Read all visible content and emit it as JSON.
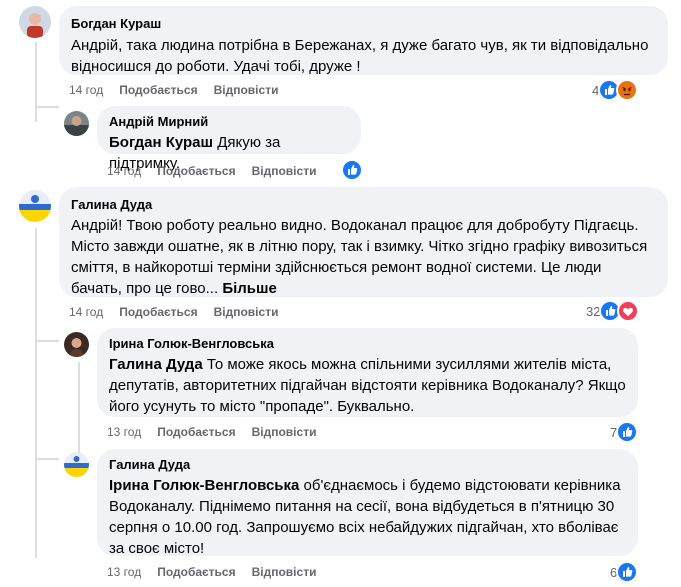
{
  "comments": [
    {
      "author": "Богдан Кураш",
      "text": "Андрій, така людина потрібна в Бережанах, я дуже багато чув, як ти відповідально відносишся до роботи. Удачі тобі, друже !",
      "time": "14 год",
      "like_label": "Подобається",
      "reply_label": "Відповісти",
      "reaction_count": "4",
      "reactions": [
        "like-icon",
        "angry-icon"
      ]
    },
    {
      "author": "Андрій Мирний",
      "mention": "Богдан Кураш",
      "text": "Дякую за підтримку.",
      "time": "14 год",
      "like_label": "Подобається",
      "reply_label": "Відповісти",
      "reaction_count": "",
      "reactions": [
        "like-icon"
      ]
    },
    {
      "author": "Галина Дуда",
      "text": "Андрій! Твою роботу реально видно. Водоканал працює для добробуту Підгаєць. Місто завжди ошатне, як в літню пору, так і взимку. Чітко згідно графіку вивозиться сміття, в найкоротші терміни здійснюється ремонт водної системи. Це люди бачать, про це гово...",
      "more_label": "Більше",
      "time": "14 год",
      "like_label": "Подобається",
      "reply_label": "Відповісти",
      "reaction_count": "32",
      "reactions": [
        "like-icon",
        "love-icon"
      ]
    },
    {
      "author": "Ірина Голюк-Венгловська",
      "mention": "Галина Дуда",
      "text": "То може якось можна спільними зусиллями жителів міста, депутатів, авторитетних підгайчан відстояти керівника Водоканалу? Якщо його усунуть то місто \"пропаде\". Буквально.",
      "time": "13 год",
      "like_label": "Подобається",
      "reply_label": "Відповісти",
      "reaction_count": "7",
      "reactions": [
        "like-icon"
      ]
    },
    {
      "author": "Галина Дуда",
      "mention": "Ірина Голюк-Венгловська",
      "text": "об'єднаємось і будемо відстоювати керівника Водоканалу. Піднімемо питання на сесії, вона відбудеться в п'ятницю 30 серпня о 10.00 год. Запрошуємо всіх небайдужих підгайчан, хто вболіває за своє місто!",
      "time": "13 год",
      "like_label": "Подобається",
      "reply_label": "Відповісти",
      "reaction_count": "6",
      "reactions": [
        "like-icon"
      ]
    }
  ],
  "colors": {
    "bubble": "#f0f2f5",
    "meta": "#65676b",
    "like": "#1877f2",
    "love": "#f33e58",
    "angry": "#e9710f"
  }
}
